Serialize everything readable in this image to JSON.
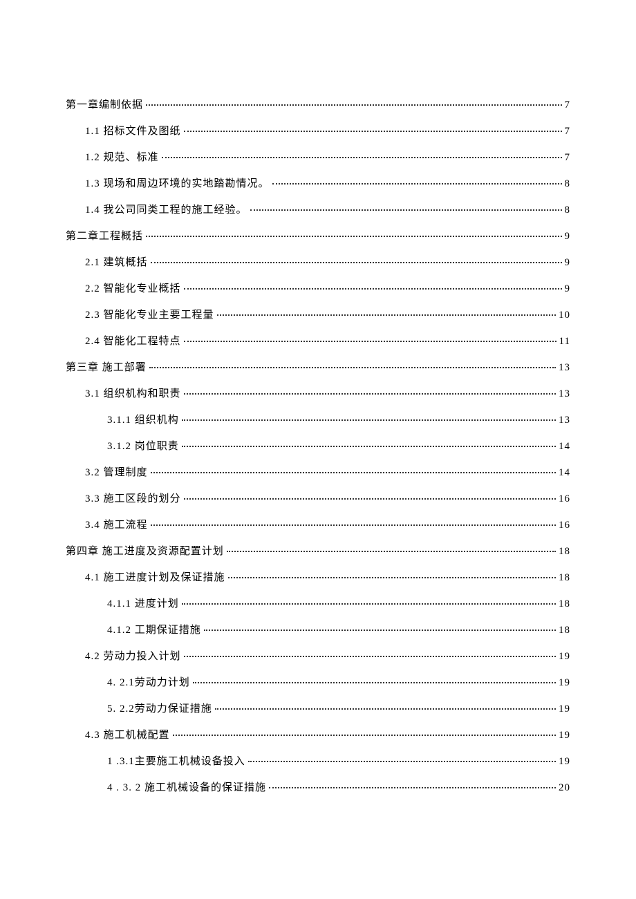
{
  "toc": [
    {
      "level": 0,
      "label": "第一章编制依据",
      "page": "7"
    },
    {
      "level": 1,
      "label": "1.1  招标文件及图纸",
      "page": "7"
    },
    {
      "level": 1,
      "label": "1.2  规范、标准",
      "page": "7"
    },
    {
      "level": 1,
      "label": "1.3  现场和周边环境的实地踏勘情况。",
      "page": "8"
    },
    {
      "level": 1,
      "label": "1.4  我公司同类工程的施工经验。",
      "page": "8"
    },
    {
      "level": 0,
      "label": "第二章工程概括",
      "page": "9"
    },
    {
      "level": 1,
      "label": "2.1  建筑概括",
      "page": "9"
    },
    {
      "level": 1,
      "label": "2.2  智能化专业概括",
      "page": "9"
    },
    {
      "level": 1,
      "label": "2.3  智能化专业主要工程量",
      "page": "10"
    },
    {
      "level": 1,
      "label": "2.4  智能化工程特点",
      "page": "11"
    },
    {
      "level": 0,
      "label": "第三章 施工部署",
      "page": "13"
    },
    {
      "level": 1,
      "label": "3.1  组织机构和职责",
      "page": "13"
    },
    {
      "level": 2,
      "label": "3.1.1 组织机构",
      "page": "13"
    },
    {
      "level": 2,
      "label": "3.1.2 岗位职责",
      "page": "14"
    },
    {
      "level": 1,
      "label": "3.2  管理制度",
      "page": "14"
    },
    {
      "level": 1,
      "label": "3.3  施工区段的划分",
      "page": "16"
    },
    {
      "level": 1,
      "label": "3.4  施工流程",
      "page": "16"
    },
    {
      "level": 0,
      "label": "第四章 施工进度及资源配置计划",
      "page": "18"
    },
    {
      "level": 1,
      "label": "4.1  施工进度计划及保证措施",
      "page": "18"
    },
    {
      "level": 2,
      "label": "4.1.1 进度计划",
      "page": "18"
    },
    {
      "level": 2,
      "label": "4.1.2 工期保证措施",
      "page": "18"
    },
    {
      "level": 1,
      "label": "4.2  劳动力投入计划",
      "page": "19"
    },
    {
      "level": 2,
      "label": "4. 2.1劳动力计划",
      "page": "19"
    },
    {
      "level": 2,
      "label": "5. 2.2劳动力保证措施",
      "page": "19"
    },
    {
      "level": 1,
      "label": "4.3  施工机械配置",
      "page": "19"
    },
    {
      "level": 2,
      "label": "1 .3.1主要施工机械设备投入",
      "page": "19"
    },
    {
      "level": 2,
      "label": "4 . 3. 2 施工机械设备的保证措施",
      "page": "20"
    }
  ]
}
